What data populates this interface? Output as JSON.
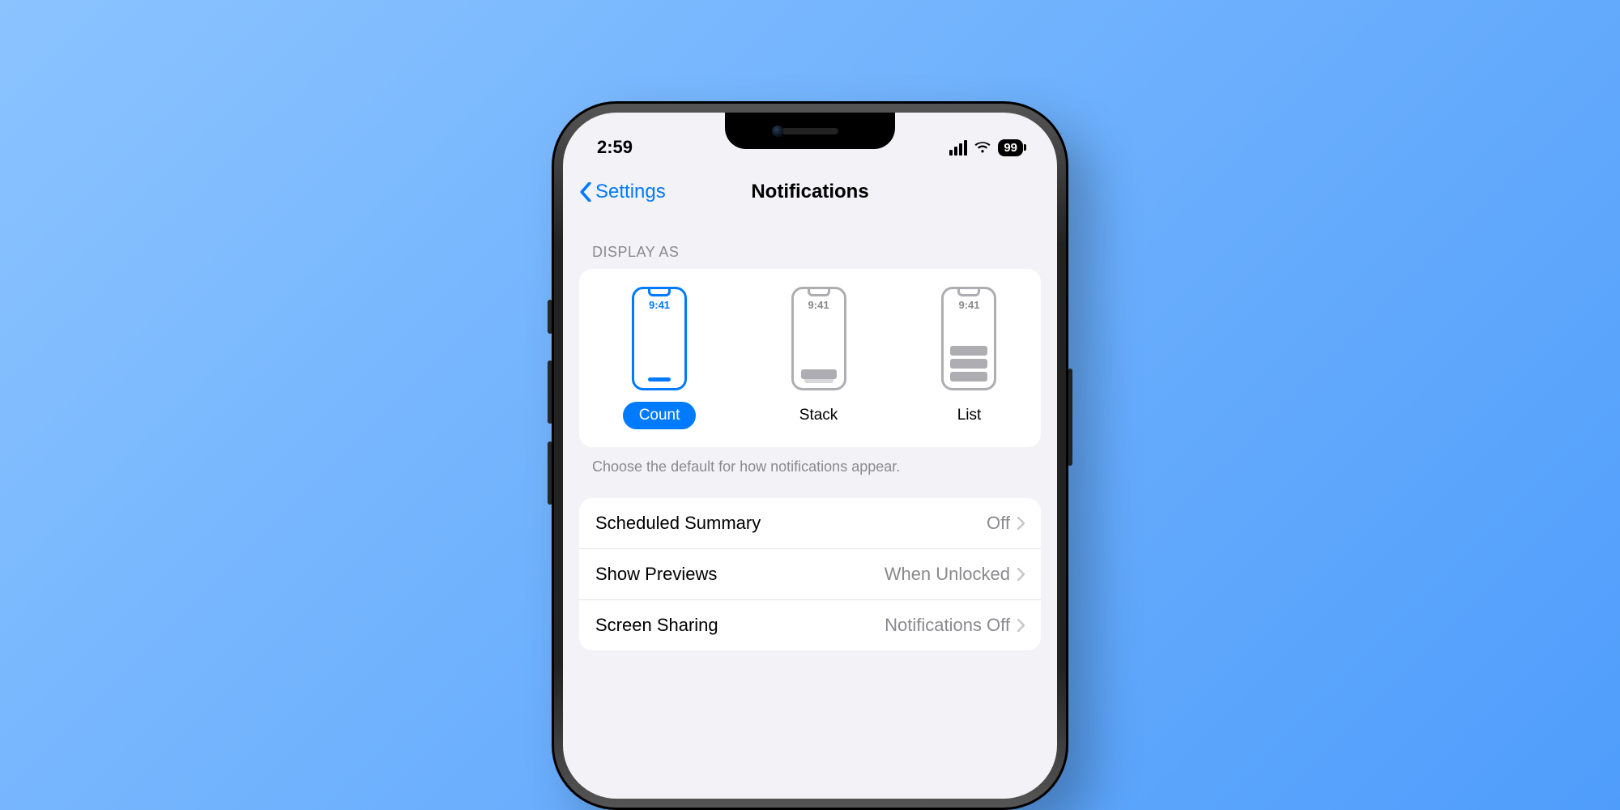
{
  "status": {
    "time": "2:59",
    "battery": "99"
  },
  "nav": {
    "back_label": "Settings",
    "title": "Notifications"
  },
  "display_section": {
    "header": "DISPLAY AS",
    "mini_time": "9:41",
    "options": [
      {
        "label": "Count",
        "selected": true
      },
      {
        "label": "Stack",
        "selected": false
      },
      {
        "label": "List",
        "selected": false
      }
    ],
    "footer": "Choose the default for how notifications appear."
  },
  "rows": [
    {
      "label": "Scheduled Summary",
      "value": "Off"
    },
    {
      "label": "Show Previews",
      "value": "When Unlocked"
    },
    {
      "label": "Screen Sharing",
      "value": "Notifications Off"
    }
  ]
}
